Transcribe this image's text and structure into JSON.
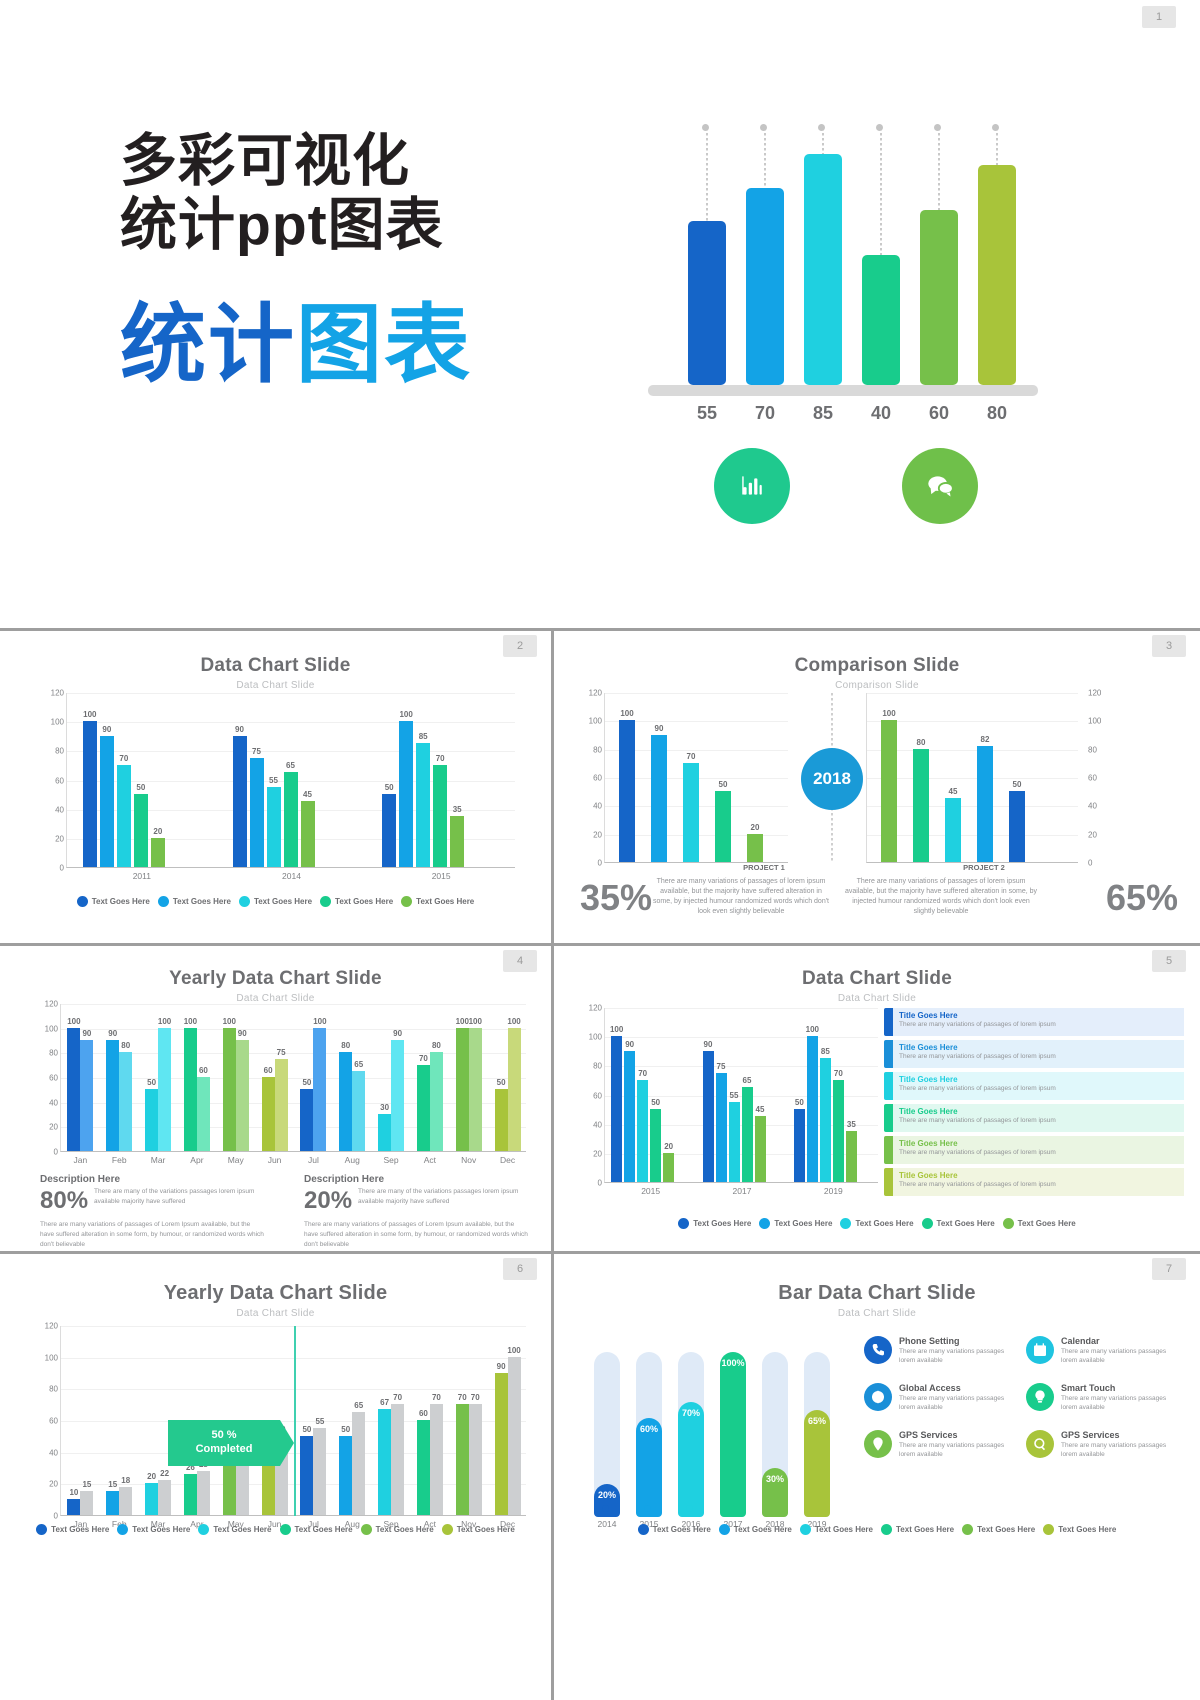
{
  "palette": {
    "c1": "#1565c8",
    "c2": "#13a3e6",
    "c3": "#1fd0e0",
    "c4": "#18cc8c",
    "c5": "#76c04a",
    "c6": "#a8c43a",
    "light1": "#4da3ef",
    "light2": "#5fd9ef",
    "light3": "#6fe6bb",
    "light4": "#a8d98b",
    "light5": "#c8d97a",
    "grey": "#c9cacc",
    "title_grey": "#6d6e71",
    "sub_grey": "#bcbec0"
  },
  "cover": {
    "badge": "1",
    "heading_line1": "多彩可视化",
    "heading_line2": "统计ppt图表",
    "big_line_a": "统计",
    "big_line_b": "图表",
    "icon_bar": "bar-chart-icon",
    "icon_chat": "chat-bubbles-icon"
  },
  "chart_data": [
    {
      "id": "hero",
      "type": "bar",
      "title": "",
      "categories": [
        "55",
        "70",
        "85",
        "40",
        "60",
        "80"
      ],
      "values": [
        55,
        70,
        85,
        40,
        60,
        80
      ],
      "colors": [
        "#1565c8",
        "#13a3e6",
        "#1fd0e0",
        "#18cc8c",
        "#76c04a",
        "#a8c43a"
      ],
      "ylim": [
        0,
        100
      ],
      "grid": false,
      "legend": "none"
    },
    {
      "id": "slide2",
      "type": "bar",
      "title": "Data Chart Slide",
      "subtitle": "Data Chart Slide",
      "categories": [
        "2011",
        "2014",
        "2015"
      ],
      "series": [
        {
          "name": "Text Goes Here",
          "color": "#1565c8",
          "values": [
            100,
            90,
            50
          ]
        },
        {
          "name": "Text Goes Here",
          "color": "#13a3e6",
          "values": [
            90,
            75,
            100
          ]
        },
        {
          "name": "Text Goes Here",
          "color": "#1fd0e0",
          "values": [
            70,
            55,
            85
          ]
        },
        {
          "name": "Text Goes Here",
          "color": "#18cc8c",
          "values": [
            50,
            65,
            70
          ]
        },
        {
          "name": "Text Goes Here",
          "color": "#76c04a",
          "values": [
            20,
            45,
            35
          ]
        }
      ],
      "yticks": [
        0,
        20,
        40,
        60,
        80,
        100,
        120
      ],
      "ylim": [
        0,
        120
      ],
      "grid": true,
      "legend": "bottom"
    },
    {
      "id": "slide3-left",
      "type": "bar",
      "title": "Comparison Slide",
      "subtitle": "Comparison Slide",
      "xlabel": "PROJECT 1",
      "categories": [
        "",
        "",
        "",
        "",
        ""
      ],
      "values": [
        100,
        90,
        70,
        50,
        20
      ],
      "colors": [
        "#1565c8",
        "#13a3e6",
        "#1fd0e0",
        "#18cc8c",
        "#76c04a"
      ],
      "yticks": [
        0,
        20,
        40,
        60,
        80,
        100,
        120
      ],
      "ylim": [
        0,
        120
      ],
      "grid": true
    },
    {
      "id": "slide3-right",
      "type": "bar",
      "xlabel": "PROJECT 2",
      "categories": [
        "",
        "",
        "",
        "",
        ""
      ],
      "values": [
        100,
        80,
        45,
        82,
        50
      ],
      "colors": [
        "#76c04a",
        "#18cc8c",
        "#1fd0e0",
        "#13a3e6",
        "#1565c8"
      ],
      "yticks": [
        0,
        20,
        40,
        60,
        80,
        100,
        120
      ],
      "ylim": [
        0,
        120
      ],
      "grid": true
    },
    {
      "id": "slide4",
      "type": "bar",
      "title": "Yearly Data Chart Slide",
      "subtitle": "Data Chart Slide",
      "categories": [
        "Jan",
        "Feb",
        "Mar",
        "Apr",
        "May",
        "Jun",
        "Jul",
        "Aug",
        "Sep",
        "Act",
        "Nov",
        "Dec"
      ],
      "series": [
        {
          "name": "primary",
          "values": [
            100,
            90,
            50,
            100,
            100,
            60,
            50,
            80,
            30,
            70,
            100,
            50
          ]
        },
        {
          "name": "secondary",
          "values": [
            90,
            80,
            100,
            60,
            90,
            75,
            100,
            65,
            90,
            80,
            100,
            100
          ]
        }
      ],
      "pair_colors": [
        [
          "#1565c8",
          "#4da3ef"
        ],
        [
          "#13a3e6",
          "#5fd9ef"
        ],
        [
          "#1fd0e0",
          "#5fe6f2"
        ],
        [
          "#18cc8c",
          "#6fe6bb"
        ],
        [
          "#76c04a",
          "#a8d98b"
        ],
        [
          "#a8c43a",
          "#c8d97a"
        ],
        [
          "#1565c8",
          "#4da3ef"
        ],
        [
          "#13a3e6",
          "#5fd9ef"
        ],
        [
          "#1fd0e0",
          "#5fe6f2"
        ],
        [
          "#18cc8c",
          "#6fe6bb"
        ],
        [
          "#76c04a",
          "#a8d98b"
        ],
        [
          "#a8c43a",
          "#c8d97a"
        ]
      ],
      "yticks": [
        0,
        20,
        40,
        60,
        80,
        100,
        120
      ],
      "ylim": [
        0,
        120
      ],
      "grid": true
    },
    {
      "id": "slide5",
      "type": "bar",
      "title": "Data Chart Slide",
      "subtitle": "Data Chart Slide",
      "categories": [
        "2015",
        "2017",
        "2019"
      ],
      "series": [
        {
          "name": "Text Goes Here",
          "color": "#1565c8",
          "values": [
            100,
            90,
            50
          ]
        },
        {
          "name": "Text Goes Here",
          "color": "#13a3e6",
          "values": [
            90,
            75,
            100
          ]
        },
        {
          "name": "Text Goes Here",
          "color": "#1fd0e0",
          "values": [
            70,
            55,
            85
          ]
        },
        {
          "name": "Text Goes Here",
          "color": "#18cc8c",
          "values": [
            50,
            65,
            70
          ]
        },
        {
          "name": "Text Goes Here",
          "color": "#76c04a",
          "values": [
            20,
            45,
            35
          ]
        }
      ],
      "yticks": [
        0,
        20,
        40,
        60,
        80,
        100,
        120
      ],
      "ylim": [
        0,
        120
      ],
      "grid": true,
      "legend": "bottom"
    },
    {
      "id": "slide6",
      "type": "bar",
      "title": "Yearly Data Chart Slide",
      "subtitle": "Data Chart Slide",
      "categories": [
        "Jan",
        "Feb",
        "Mar",
        "Apr",
        "May",
        "Jun",
        "Jul",
        "Aug",
        "Sep",
        "Act",
        "Nov",
        "Dec"
      ],
      "series": [
        {
          "name": "colored",
          "values": [
            10,
            15,
            20,
            25,
            26,
            33,
            45,
            50,
            55,
            67,
            60,
            70,
            70,
            90
          ]
        },
        {
          "name": "grey",
          "values": [
            15,
            18,
            22,
            28,
            39,
            50,
            55,
            65,
            70,
            70,
            70,
            100
          ]
        }
      ],
      "colored_values": [
        10,
        15,
        20,
        25,
        26,
        33,
        45,
        50,
        55,
        67,
        60,
        70,
        90
      ],
      "grey_values": [
        15,
        18,
        22,
        28,
        39,
        50,
        55,
        65,
        70,
        70,
        70,
        100
      ],
      "pairs": [
        {
          "cat": "Jan",
          "c": 10,
          "g": 15,
          "color": "#1565c8"
        },
        {
          "cat": "Feb",
          "c": 15,
          "g": 18,
          "color": "#13a3e6"
        },
        {
          "cat": "Mar",
          "c": 20,
          "g": 22,
          "color": "#1fd0e0"
        },
        {
          "cat": "Apr",
          "c": 26,
          "g": 28,
          "color": "#18cc8c"
        },
        {
          "cat": "May",
          "c": 33,
          "g": 39,
          "color": "#76c04a"
        },
        {
          "cat": "Jun",
          "c": 45,
          "g": 50,
          "color": "#a8c43a"
        },
        {
          "cat": "Jul",
          "c": 50,
          "g": 55,
          "color": "#1565c8"
        },
        {
          "cat": "Aug",
          "c": 50,
          "g": 65,
          "color": "#13a3e6"
        },
        {
          "cat": "Sep",
          "c": 67,
          "g": 70,
          "color": "#1fd0e0"
        },
        {
          "cat": "Act",
          "c": 60,
          "g": 70,
          "color": "#18cc8c"
        },
        {
          "cat": "Nov",
          "c": 70,
          "g": 70,
          "color": "#76c04a"
        },
        {
          "cat": "Dec",
          "c": 90,
          "g": 100,
          "color": "#a8c43a"
        }
      ],
      "flag_label_line1": "50 %",
      "flag_label_line2": "Completed",
      "flag_color": "#24c98e",
      "yticks": [
        0,
        20,
        40,
        60,
        80,
        100,
        120
      ],
      "ylim": [
        0,
        120
      ],
      "grid": true,
      "legend": "bottom"
    },
    {
      "id": "slide7",
      "type": "bar",
      "title": "Bar Data Chart Slide",
      "subtitle": "Data Chart Slide",
      "categories": [
        "2014",
        "2015",
        "2016",
        "2017",
        "2018",
        "2019"
      ],
      "values": [
        20,
        60,
        70,
        100,
        30,
        65
      ],
      "value_labels": [
        "20%",
        "60%",
        "70%",
        "100%",
        "30%",
        "65%"
      ],
      "colors": [
        "#1565c8",
        "#13a3e6",
        "#1fd0e0",
        "#18cc8c",
        "#76c04a",
        "#a8c43a"
      ],
      "track_color": "#dfeaf7",
      "ylim": [
        0,
        100
      ],
      "legend": "bottom"
    }
  ],
  "slide2": {
    "badge": "2",
    "title": "Data Chart Slide",
    "subtitle": "Data Chart Slide",
    "legend_labels": [
      "Text Goes Here",
      "Text Goes Here",
      "Text Goes Here",
      "Text Goes Here",
      "Text Goes Here"
    ]
  },
  "slide3": {
    "badge": "3",
    "title": "Comparison Slide",
    "subtitle": "Comparison Slide",
    "year": "2018",
    "left_pct": "35%",
    "right_pct": "65%",
    "left_project": "PROJECT 1",
    "right_project": "PROJECT 2",
    "left_body": "There are many variations of passages of lorem ipsum available, but the majority have suffered alteration in some, by injected humour randomized words which don't look even slightly believable",
    "right_body": "There are many variations of passages of lorem ipsum available, but the majority have suffered alteration in some, by injected humour randomized words which don't look even slightly believable"
  },
  "slide4": {
    "badge": "4",
    "title": "Yearly Data Chart Slide",
    "subtitle": "Data Chart Slide",
    "blocks": [
      {
        "heading": "Description Here",
        "pct": "80%",
        "lead": "There are many of the variations passages lorem ipsum available majority have suffered",
        "body": "There are many variations of passages of Lorem Ipsum available, but the have suffered alteration in some form, by humour, or randomized words which don't believable"
      },
      {
        "heading": "Description Here",
        "pct": "20%",
        "lead": "There are many of the variations passages lorem ipsum available majority have suffered",
        "body": "There are many variations of passages of Lorem Ipsum available, but the have suffered alteration in some form, by humour, or randomized words which don't believable"
      }
    ]
  },
  "slide5": {
    "badge": "5",
    "title": "Data Chart Slide",
    "subtitle": "Data Chart Slide",
    "items": [
      {
        "title": "Title Goes Here",
        "desc": "There are many variations of passages of lorem ipsum",
        "color": "#1565c8",
        "bg": "#e4eefb"
      },
      {
        "title": "Title Goes Here",
        "desc": "There are many variations of passages of lorem ipsum",
        "color": "#1a8fd8",
        "bg": "#e2f1fb"
      },
      {
        "title": "Title Goes Here",
        "desc": "There are many variations of passages of lorem ipsum",
        "color": "#1fd0e0",
        "bg": "#e0f8fb"
      },
      {
        "title": "Title Goes Here",
        "desc": "There are many variations of passages of lorem ipsum",
        "color": "#18cc8c",
        "bg": "#e0f8f0"
      },
      {
        "title": "Title Goes Here",
        "desc": "There are many variations of passages of lorem ipsum",
        "color": "#76c04a",
        "bg": "#eaf5e2"
      },
      {
        "title": "Title Goes Here",
        "desc": "There are many variations of passages of lorem ipsum",
        "color": "#a8c43a",
        "bg": "#f1f5e0"
      }
    ],
    "legend_labels": [
      "Text Goes Here",
      "Text Goes Here",
      "Text Goes Here",
      "Text Goes Here",
      "Text Goes Here"
    ]
  },
  "slide6": {
    "badge": "6",
    "title": "Yearly Data Chart Slide",
    "subtitle": "Data Chart Slide",
    "legend_labels": [
      "Text Goes Here",
      "Text Goes Here",
      "Text Goes Here",
      "Text Goes Here",
      "Text Goes Here",
      "Text Goes Here"
    ]
  },
  "slide7": {
    "badge": "7",
    "title": "Bar Data Chart Slide",
    "subtitle": "Data Chart Slide",
    "features": [
      {
        "icon": "phone-icon",
        "title": "Phone Setting",
        "desc": "There are many variations passages lorem available",
        "color": "#1565c8"
      },
      {
        "icon": "calendar-icon",
        "title": "Calendar",
        "desc": "There are many variations passages lorem available",
        "color": "#1fc4e0"
      },
      {
        "icon": "globe-icon",
        "title": "Global Access",
        "desc": "There are many variations passages lorem available",
        "color": "#1a8fd8"
      },
      {
        "icon": "bulb-icon",
        "title": "Smart Touch",
        "desc": "There are many variations passages lorem available",
        "color": "#18cc8c"
      },
      {
        "icon": "pin-icon",
        "title": "GPS Services",
        "desc": "There are many variations passages lorem available",
        "color": "#76c04a"
      },
      {
        "icon": "search-icon",
        "title": "GPS Services",
        "desc": "There are many variations passages lorem available",
        "color": "#a8c43a"
      }
    ],
    "legend_labels": [
      "Text Goes Here",
      "Text Goes Here",
      "Text Goes Here",
      "Text Goes Here",
      "Text Goes Here",
      "Text Goes Here"
    ]
  }
}
